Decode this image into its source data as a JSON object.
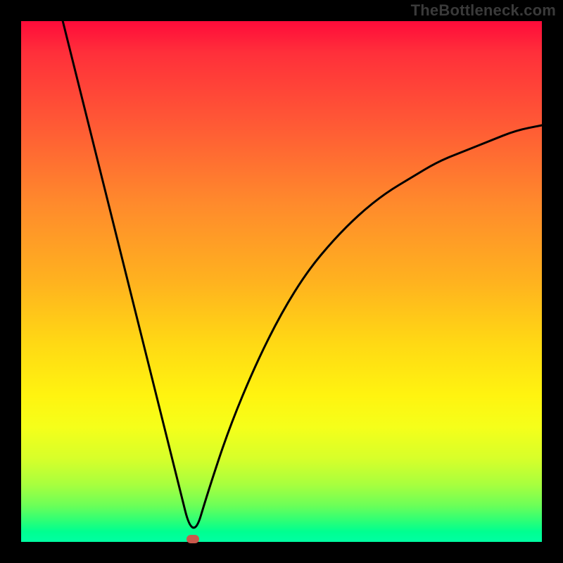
{
  "watermark": "TheBottleneck.com",
  "chart_data": {
    "type": "line",
    "title": "",
    "xlabel": "",
    "ylabel": "",
    "xlim": [
      0,
      100
    ],
    "ylim": [
      0,
      100
    ],
    "background_gradient": {
      "top": "#ff0b3a",
      "bottom": "#00ffa3"
    },
    "curve": {
      "description": "V-shaped bottleneck curve",
      "left_branch_start": {
        "x": 8,
        "y": 100
      },
      "minimum": {
        "x": 33,
        "y": 0
      },
      "right_branch_end": {
        "x": 100,
        "y": 80
      }
    },
    "marker": {
      "x": 33,
      "y": 0.5,
      "color": "#c9594c"
    },
    "series": [
      {
        "name": "bottleneck",
        "x": [
          8,
          10,
          14,
          18,
          22,
          26,
          30,
          33,
          36,
          40,
          45,
          50,
          55,
          60,
          65,
          70,
          75,
          80,
          85,
          90,
          95,
          100
        ],
        "values": [
          100,
          92,
          76,
          60,
          44,
          28,
          12,
          0,
          10,
          22,
          34,
          44,
          52,
          58,
          63,
          67,
          70,
          73,
          75,
          77,
          79,
          80
        ]
      }
    ]
  }
}
